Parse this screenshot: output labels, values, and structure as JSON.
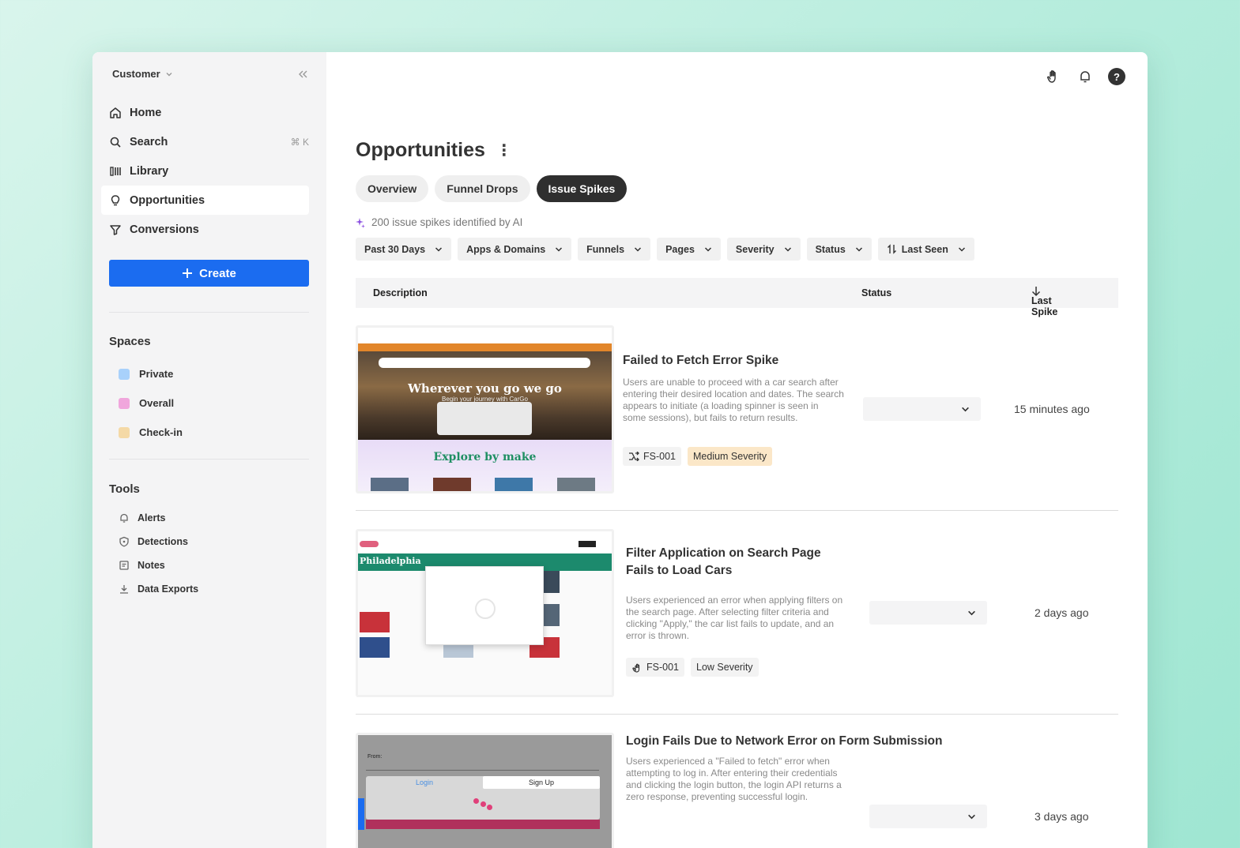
{
  "sidebar": {
    "account": "Customer",
    "nav": [
      {
        "label": "Home"
      },
      {
        "label": "Search",
        "shortcut": "⌘ K"
      },
      {
        "label": "Library"
      },
      {
        "label": "Opportunities"
      },
      {
        "label": "Conversions"
      }
    ],
    "create_label": "Create",
    "spaces_title": "Spaces",
    "spaces": [
      {
        "label": "Private",
        "color": "#a8d1fb"
      },
      {
        "label": "Overall",
        "color": "#f0a6dc"
      },
      {
        "label": "Check-in",
        "color": "#f4d9a6"
      }
    ],
    "tools_title": "Tools",
    "tools": [
      {
        "label": "Alerts"
      },
      {
        "label": "Detections"
      },
      {
        "label": "Notes"
      },
      {
        "label": "Data Exports"
      }
    ]
  },
  "header": {
    "title": "Opportunities",
    "tabs": [
      {
        "label": "Overview"
      },
      {
        "label": "Funnel Drops"
      },
      {
        "label": "Issue Spikes"
      }
    ],
    "ai_note": "200 issue spikes identified by AI"
  },
  "filters": [
    "Past 30 Days",
    "Apps & Domains",
    "Funnels",
    "Pages",
    "Severity",
    "Status",
    "Last Seen"
  ],
  "table": {
    "col_description": "Description",
    "col_status": "Status",
    "col_last_spike": "Last Spike"
  },
  "issues": [
    {
      "title": "Failed to Fetch Error Spike",
      "description": "Users are unable to proceed with a car search after entering their desired location and dates. The search appears to initiate (a loading spinner is seen in some sessions), but fails to return results.",
      "id": "FS-001",
      "severity": "Medium Severity",
      "last_spike": "15 minutes ago",
      "thumb_headline": "Wherever you go we go",
      "thumb_sub": "Begin your journey with CarGo",
      "thumb_section": "Explore by make"
    },
    {
      "title": "Filter Application on Search Page Fails to Load Cars",
      "description": "Users experienced an error when applying filters on the search page. After selecting filter criteria and clicking \"Apply,\" the car list fails to update, and an error is thrown.",
      "id": "FS-001",
      "severity": "Low Severity",
      "last_spike": "2 days ago",
      "thumb_city": "Philadelphia"
    },
    {
      "title": "Login Fails Due to Network Error on Form Submission",
      "description": "Users experienced a \"Failed to fetch\" error when attempting to log in. After entering their credentials and clicking the login button, the login API returns a zero response, preventing successful login.",
      "last_spike": "3 days ago",
      "thumb_login": "Login",
      "thumb_signup": "Sign Up",
      "thumb_from": "From:"
    }
  ]
}
